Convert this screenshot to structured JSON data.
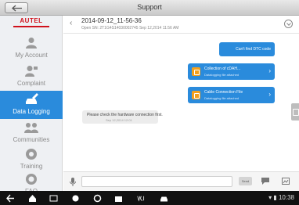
{
  "header": {
    "title": "Support"
  },
  "logo": {
    "text": "AUTEL"
  },
  "sidebar": {
    "items": [
      {
        "label": "My Account",
        "icon": "person-icon"
      },
      {
        "label": "Complaint",
        "icon": "complaint-icon"
      },
      {
        "label": "Data Logging",
        "icon": "car-pen-icon",
        "active": true
      },
      {
        "label": "Communities",
        "icon": "group-icon"
      },
      {
        "label": "Training",
        "icon": "training-icon"
      },
      {
        "label": "FAQ",
        "icon": "faq-icon"
      }
    ]
  },
  "conversation": {
    "title": "2014-09-12_11-56-36",
    "status": "Open",
    "meta": "SN: 2T1G4S14030002745   Sep 12,2014 11:56 AM"
  },
  "messages": {
    "outgoing_text": "Can't find DTC code",
    "attachments": [
      {
        "title": "Collection of cDAH...",
        "sub": "Datalogging file attached"
      },
      {
        "title": "Cable Connection File",
        "sub": "Datalogging file attached"
      }
    ],
    "incoming": {
      "text": "Please check the hardware connection first.",
      "time": "Sep 12,2014 12:01"
    }
  },
  "composer": {
    "placeholder": "",
    "send_label": "Send"
  },
  "statusbar": {
    "time": "10:38"
  },
  "colors": {
    "accent": "#2a8bdc",
    "brand": "#d0111b",
    "file_icon": "#f2a01d"
  }
}
